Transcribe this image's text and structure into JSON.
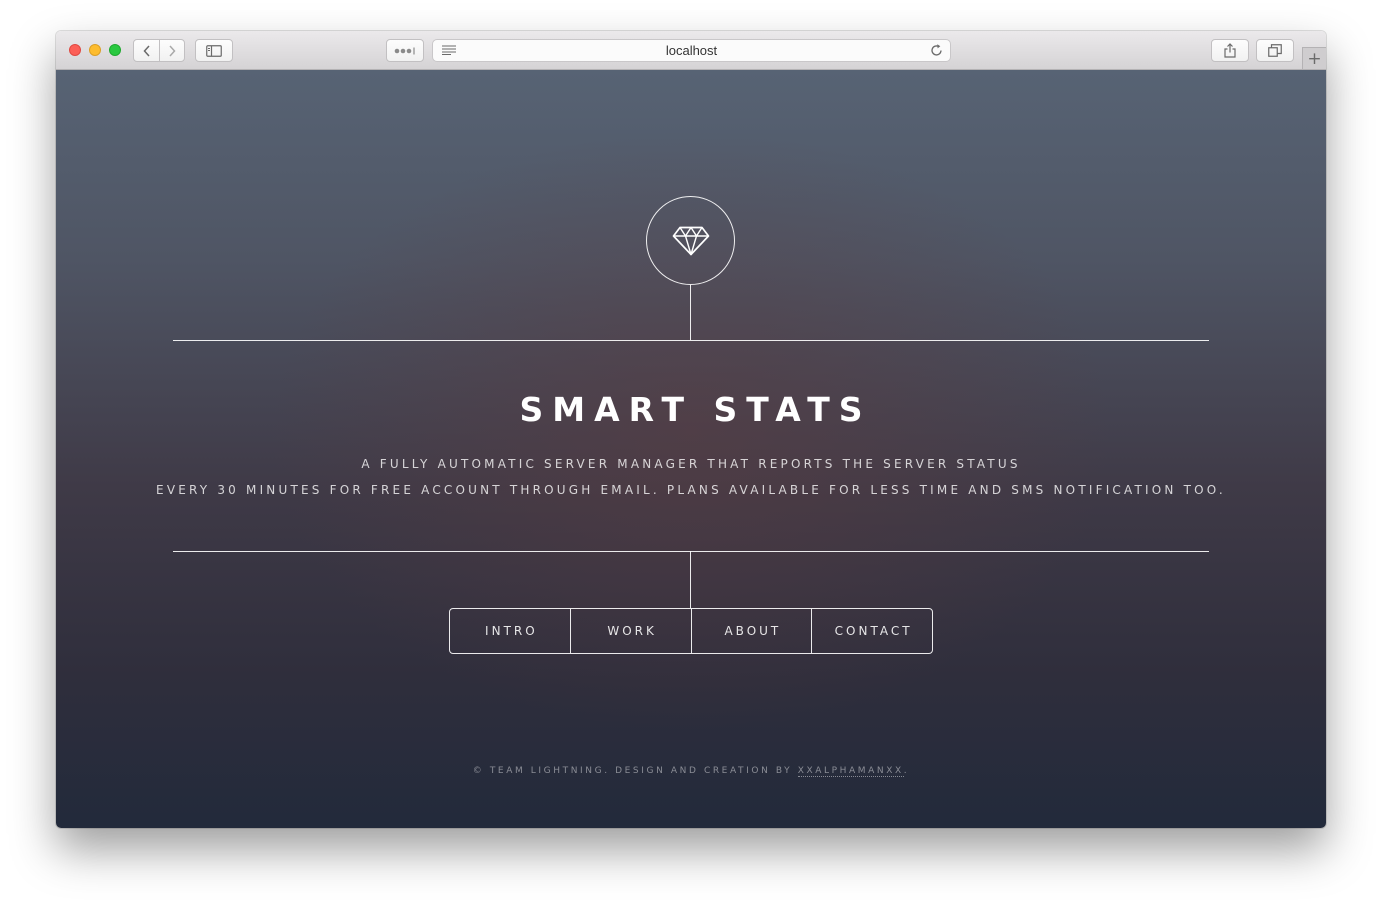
{
  "browser": {
    "url": "localhost",
    "new_tab_symbol": "+",
    "icons": {
      "back": "chevron-left-icon",
      "forward": "chevron-right-icon",
      "sidebar": "sidebar-icon",
      "extensions": "dots-icon",
      "reader": "reader-lines-icon",
      "reload": "reload-icon",
      "share": "share-icon",
      "tabs": "tabs-overview-icon"
    }
  },
  "hero": {
    "logo_icon": "diamond-icon",
    "title": "SMART STATS",
    "subtitle_line1": "A FULLY AUTOMATIC SERVER MANAGER THAT REPORTS THE SERVER STATUS",
    "subtitle_line2": "EVERY 30 MINUTES FOR FREE ACCOUNT THROUGH EMAIL. PLANS AVAILABLE FOR LESS TIME AND SMS NOTIFICATION TOO."
  },
  "nav": {
    "items": [
      {
        "label": "INTRO"
      },
      {
        "label": "WORK"
      },
      {
        "label": "ABOUT"
      },
      {
        "label": "CONTACT"
      }
    ]
  },
  "footer": {
    "text": "© TEAM LIGHTNING. DESIGN AND CREATION BY ",
    "author": "XXALPHAMANXX",
    "end": "."
  },
  "colors": {
    "close": "#fc5f57",
    "minimize": "#fdbc2e",
    "zoom": "#29c840",
    "page_top": "#576374",
    "page_bottom": "#222a3b"
  }
}
